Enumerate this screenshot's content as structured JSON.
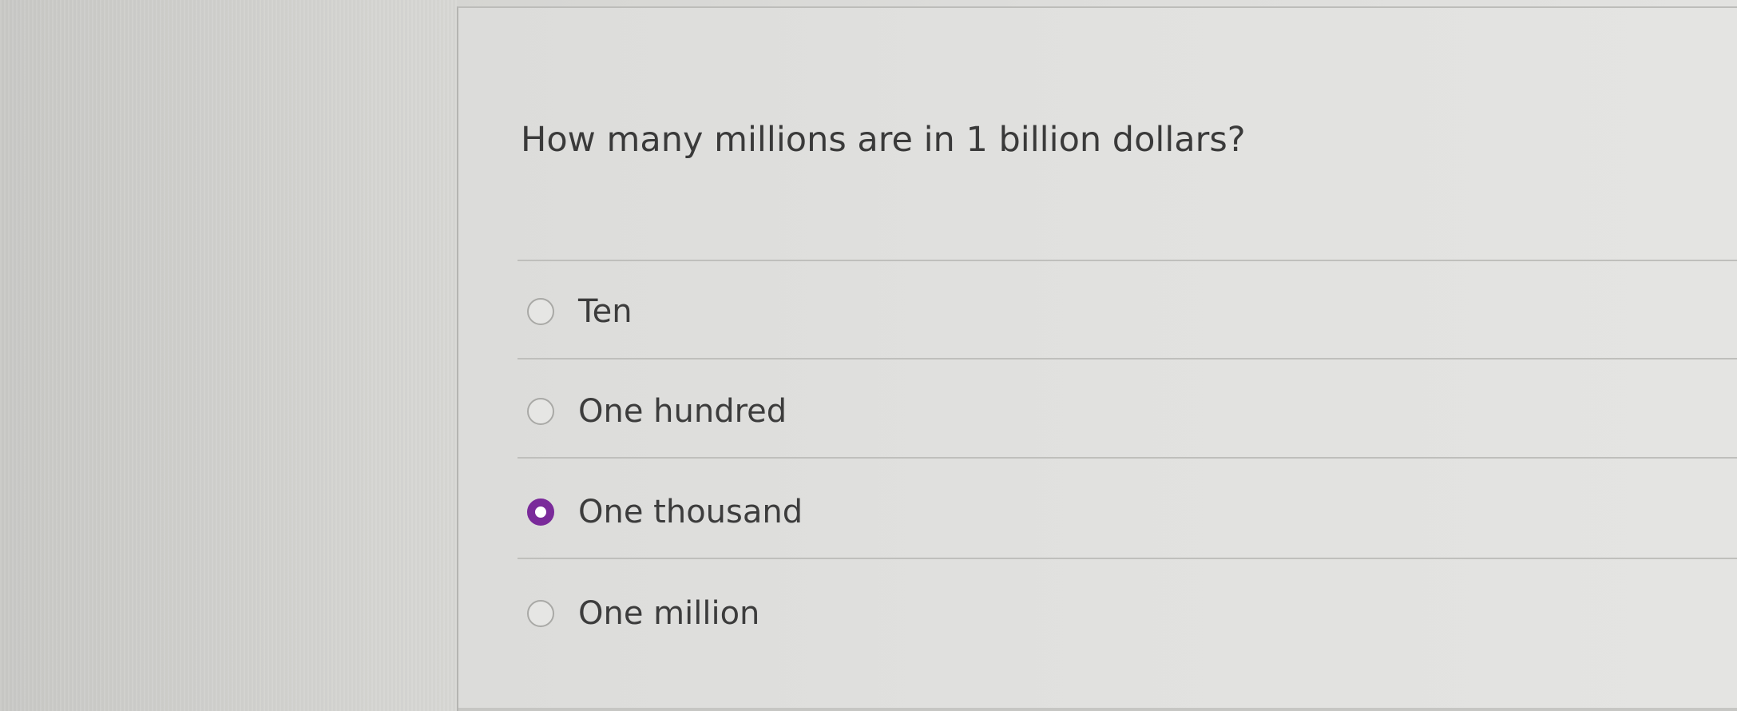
{
  "question": {
    "text": "How many millions are in 1 billion dollars?"
  },
  "options": [
    {
      "label": "Ten",
      "selected": false
    },
    {
      "label": "One hundred",
      "selected": false
    },
    {
      "label": "One thousand",
      "selected": true
    },
    {
      "label": "One million",
      "selected": false
    }
  ],
  "colors": {
    "selected_radio": "#7a2a9a",
    "text": "#3c3c3c"
  }
}
